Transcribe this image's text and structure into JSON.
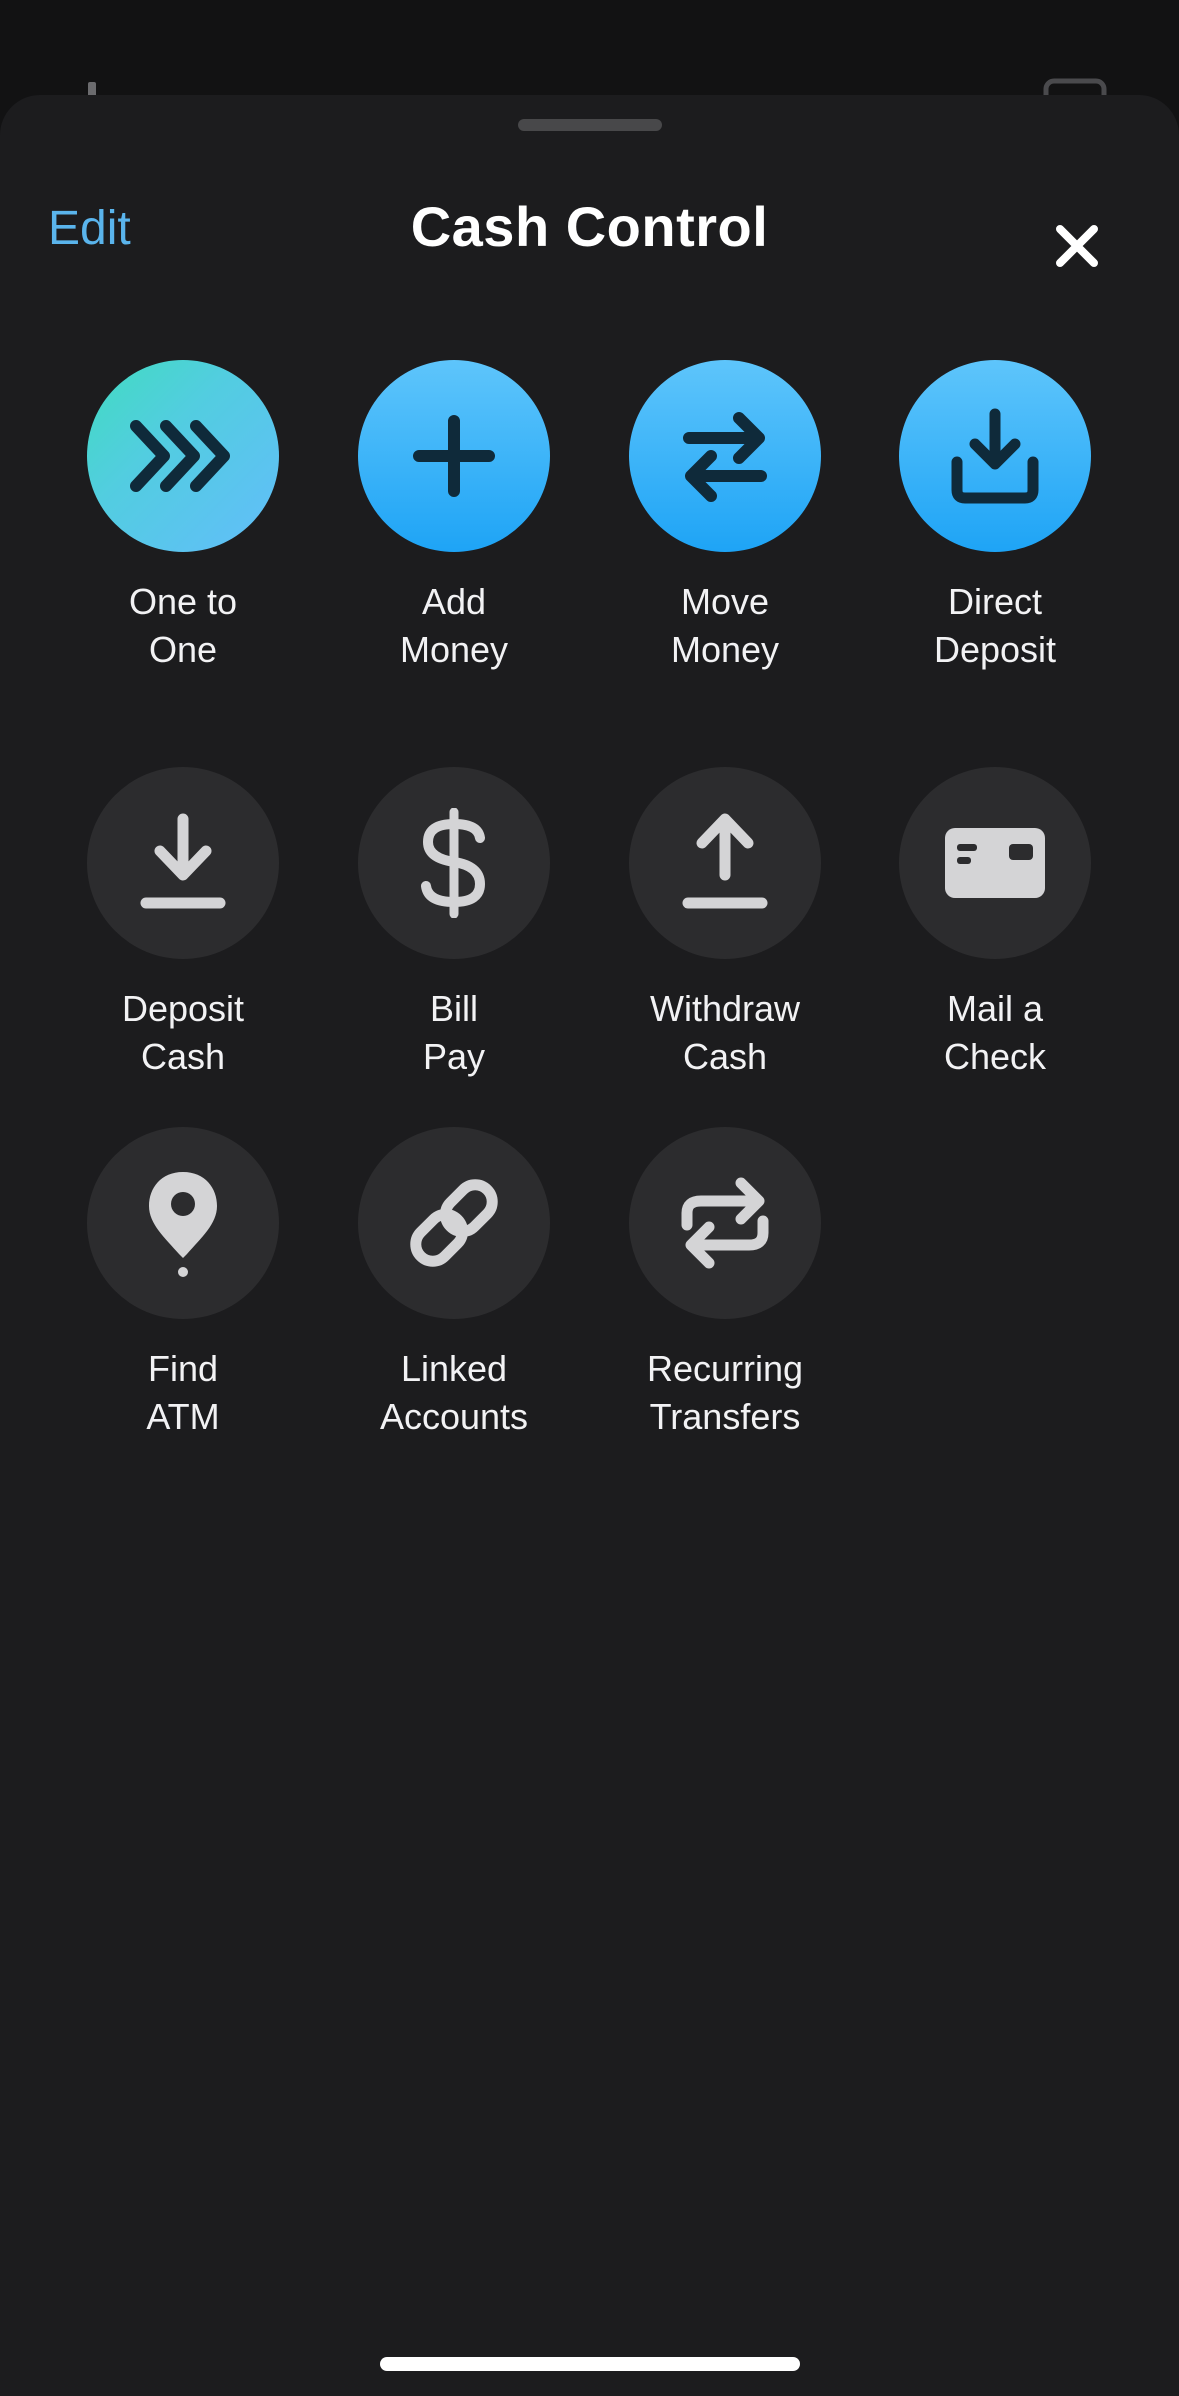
{
  "sheet": {
    "title": "Cash Control",
    "edit_label": "Edit",
    "close_icon": "close-icon"
  },
  "colors": {
    "accent": "#5ab4ec",
    "primary_gradient_start": "#5ec5fb",
    "primary_gradient_end": "#1ea4f6",
    "teal_start": "#41dcc0",
    "tile_secondary": "#2c2c2e",
    "sheet_bg": "#1c1c1e"
  },
  "actions": [
    {
      "line1": "One to",
      "line2": "One",
      "icon": "triple-chevron-right-icon",
      "style": "primary-teal"
    },
    {
      "line1": "Add",
      "line2": "Money",
      "icon": "plus-icon",
      "style": "primary"
    },
    {
      "line1": "Move",
      "line2": "Money",
      "icon": "swap-arrows-icon",
      "style": "primary"
    },
    {
      "line1": "Direct",
      "line2": "Deposit",
      "icon": "download-tray-icon",
      "style": "primary"
    },
    {
      "line1": "Deposit",
      "line2": "Cash",
      "icon": "download-icon",
      "style": "secondary"
    },
    {
      "line1": "Bill",
      "line2": "Pay",
      "icon": "dollar-icon",
      "style": "secondary"
    },
    {
      "line1": "Withdraw",
      "line2": "Cash",
      "icon": "upload-icon",
      "style": "secondary"
    },
    {
      "line1": "Mail a",
      "line2": "Check",
      "icon": "check-card-icon",
      "style": "secondary"
    },
    {
      "line1": "Find",
      "line2": "ATM",
      "icon": "location-pin-icon",
      "style": "secondary"
    },
    {
      "line1": "Linked",
      "line2": "Accounts",
      "icon": "link-icon",
      "style": "secondary"
    },
    {
      "line1": "Recurring",
      "line2": "Transfers",
      "icon": "repeat-icon",
      "style": "secondary"
    }
  ]
}
